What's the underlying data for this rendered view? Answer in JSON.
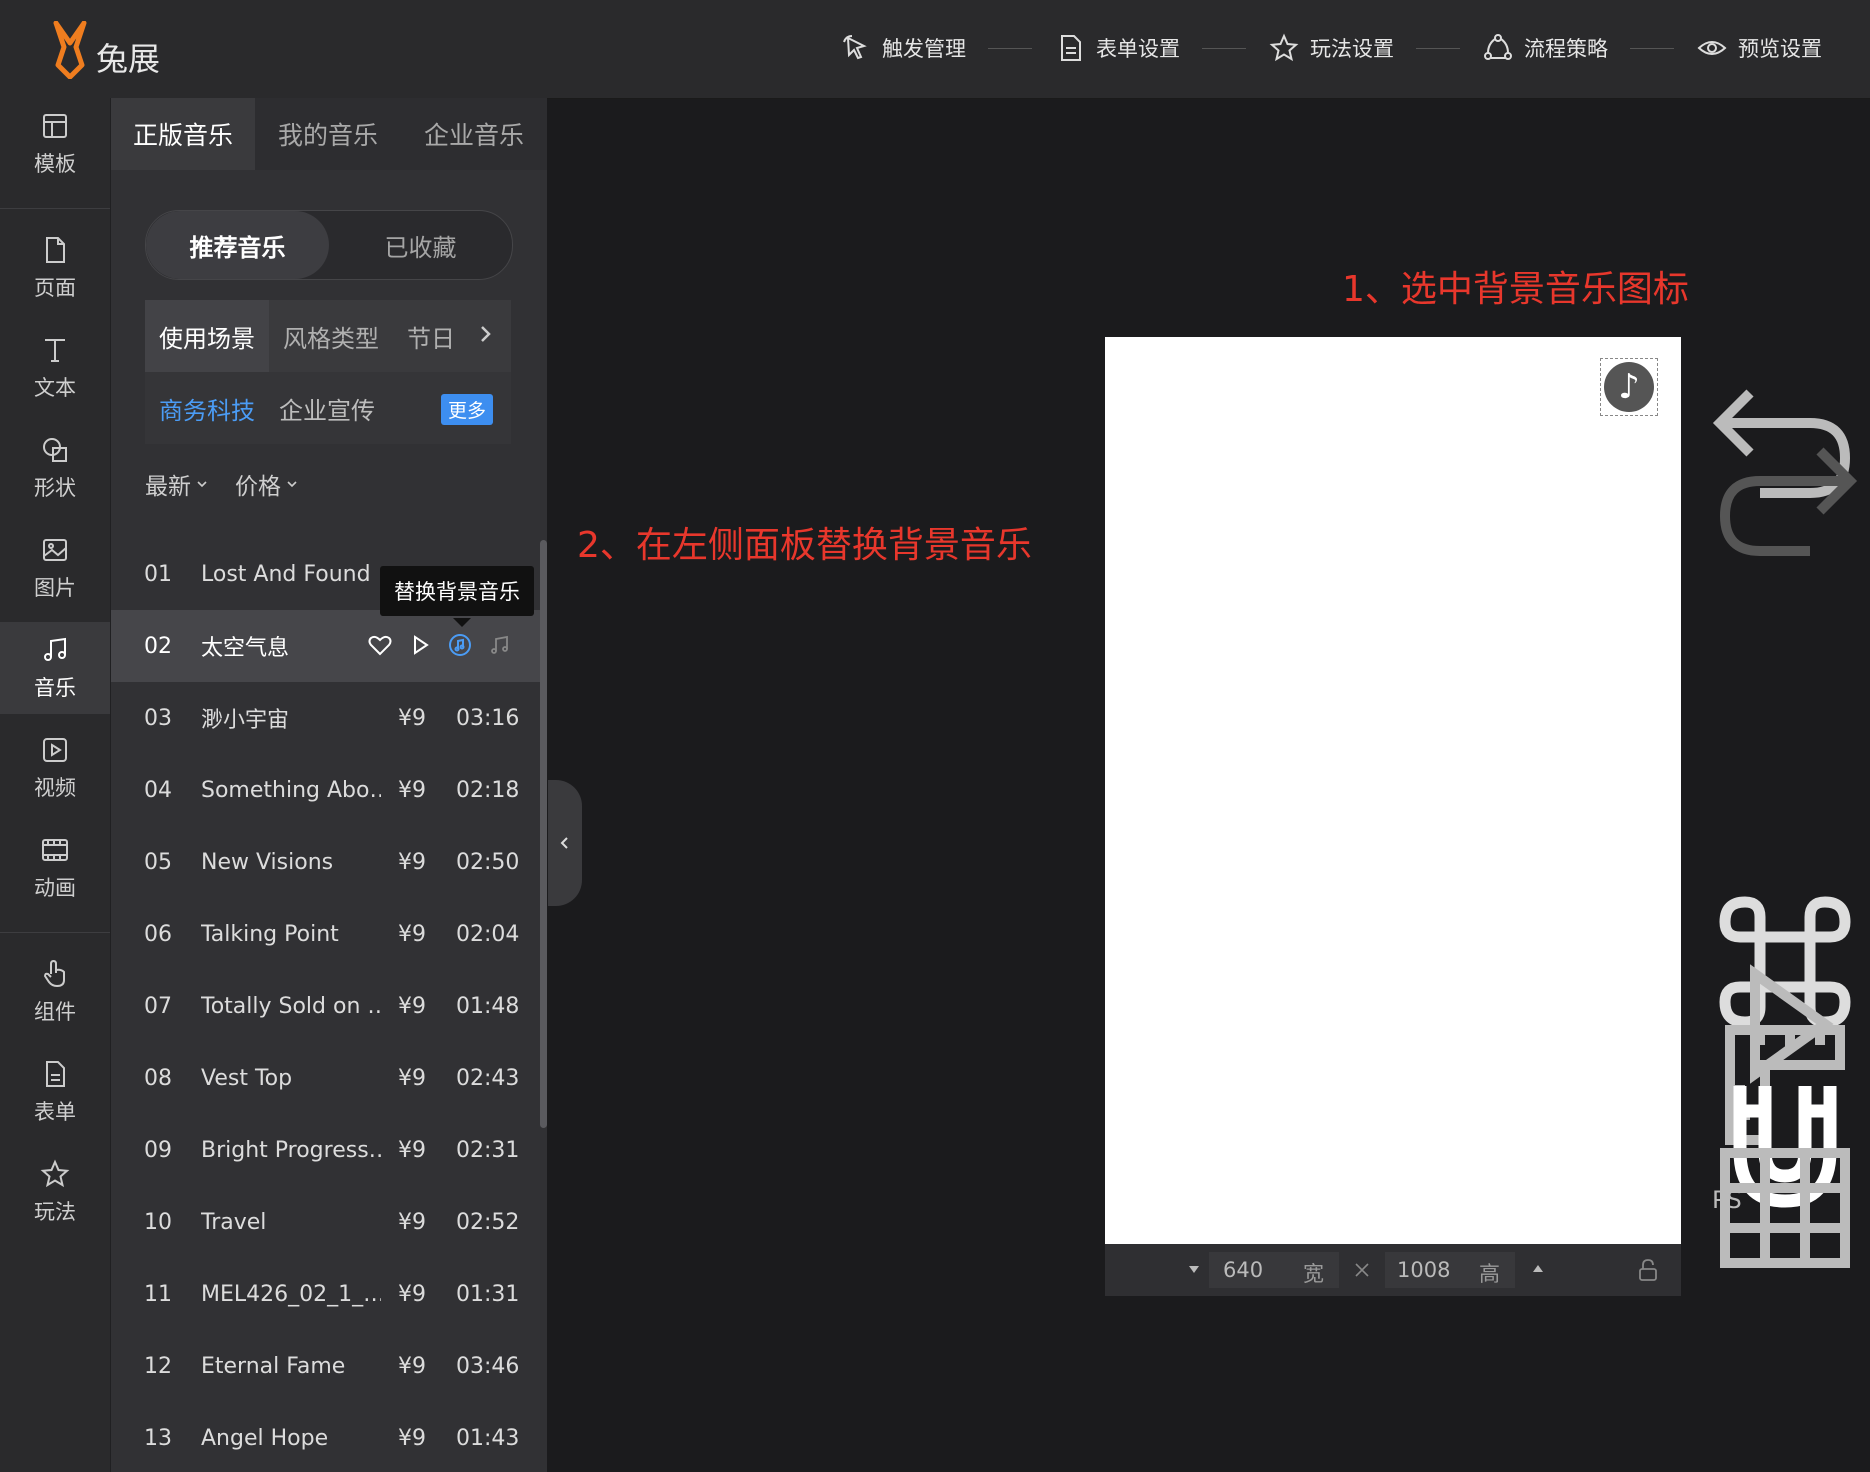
{
  "app": {
    "logo_text": "兔展"
  },
  "header": {
    "steps": [
      {
        "label": "触发管理",
        "icon": "cursor-click-icon"
      },
      {
        "label": "表单设置",
        "icon": "document-icon"
      },
      {
        "label": "玩法设置",
        "icon": "star-icon"
      },
      {
        "label": "流程策略",
        "icon": "flow-icon"
      },
      {
        "label": "预览设置",
        "icon": "eye-icon"
      }
    ]
  },
  "sidebar": {
    "items": [
      {
        "label": "模板",
        "icon": "template-icon"
      },
      {
        "label": "页面",
        "icon": "page-icon"
      },
      {
        "label": "文本",
        "icon": "text-icon"
      },
      {
        "label": "形状",
        "icon": "shape-icon"
      },
      {
        "label": "图片",
        "icon": "image-icon"
      },
      {
        "label": "音乐",
        "icon": "music-icon",
        "active": true
      },
      {
        "label": "视频",
        "icon": "video-icon"
      },
      {
        "label": "动画",
        "icon": "animation-icon"
      },
      {
        "label": "组件",
        "icon": "hand-pointer-icon"
      },
      {
        "label": "表单",
        "icon": "form-icon"
      },
      {
        "label": "玩法",
        "icon": "star-icon"
      }
    ]
  },
  "panel": {
    "tabs": [
      {
        "label": "正版音乐",
        "active": true
      },
      {
        "label": "我的音乐"
      },
      {
        "label": "企业音乐"
      }
    ],
    "segment": [
      {
        "label": "推荐音乐",
        "active": true
      },
      {
        "label": "已收藏"
      }
    ],
    "categories": [
      {
        "label": "使用场景",
        "active": true
      },
      {
        "label": "风格类型"
      },
      {
        "label": "节日"
      }
    ],
    "subcategories": [
      {
        "label": "商务科技",
        "active": true
      },
      {
        "label": "企业宣传"
      }
    ],
    "more_label": "更多",
    "sorts": [
      {
        "label": "最新"
      },
      {
        "label": "价格"
      }
    ],
    "tooltip": "替换背景音乐",
    "tracks": [
      {
        "num": "01",
        "name": "Lost And Found",
        "price": "",
        "duration": ""
      },
      {
        "num": "02",
        "name": "太空气息",
        "price": "",
        "duration": "",
        "hover": true
      },
      {
        "num": "03",
        "name": "渺小宇宙",
        "price": "¥9",
        "duration": "03:16"
      },
      {
        "num": "04",
        "name": "Something Abo…",
        "price": "¥9",
        "duration": "02:18"
      },
      {
        "num": "05",
        "name": "New Visions",
        "price": "¥9",
        "duration": "02:50"
      },
      {
        "num": "06",
        "name": "Talking Point",
        "price": "¥9",
        "duration": "02:04"
      },
      {
        "num": "07",
        "name": "Totally Sold on …",
        "price": "¥9",
        "duration": "01:48"
      },
      {
        "num": "08",
        "name": "Vest Top",
        "price": "¥9",
        "duration": "02:43"
      },
      {
        "num": "09",
        "name": "Bright Progress…",
        "price": "¥9",
        "duration": "02:31"
      },
      {
        "num": "10",
        "name": "Travel",
        "price": "¥9",
        "duration": "02:52"
      },
      {
        "num": "11",
        "name": "MEL426_02_1_…",
        "price": "¥9",
        "duration": "01:31"
      },
      {
        "num": "12",
        "name": "Eternal Fame",
        "price": "¥9",
        "duration": "03:46"
      },
      {
        "num": "13",
        "name": "Angel Hope",
        "price": "¥9",
        "duration": "01:43"
      }
    ]
  },
  "annotations": {
    "step1": "1、选中背景音乐图标",
    "step2": "2、在左侧面板替换背景音乐"
  },
  "canvas": {
    "width_value": "640",
    "width_label": "宽",
    "height_value": "1008",
    "height_label": "高",
    "music_badge_glyph": "♪"
  },
  "right_tools": {
    "icons": [
      "undo-icon",
      "redo-icon",
      "command-icon",
      "play-icon",
      "ruler-icon",
      "magnet-icon",
      "grid-icon"
    ],
    "ps_label": "PS"
  },
  "colors": {
    "accent_blue": "#4b9cf5",
    "annotation_red": "#e8372c",
    "logo_orange": "#ef7d1f"
  }
}
